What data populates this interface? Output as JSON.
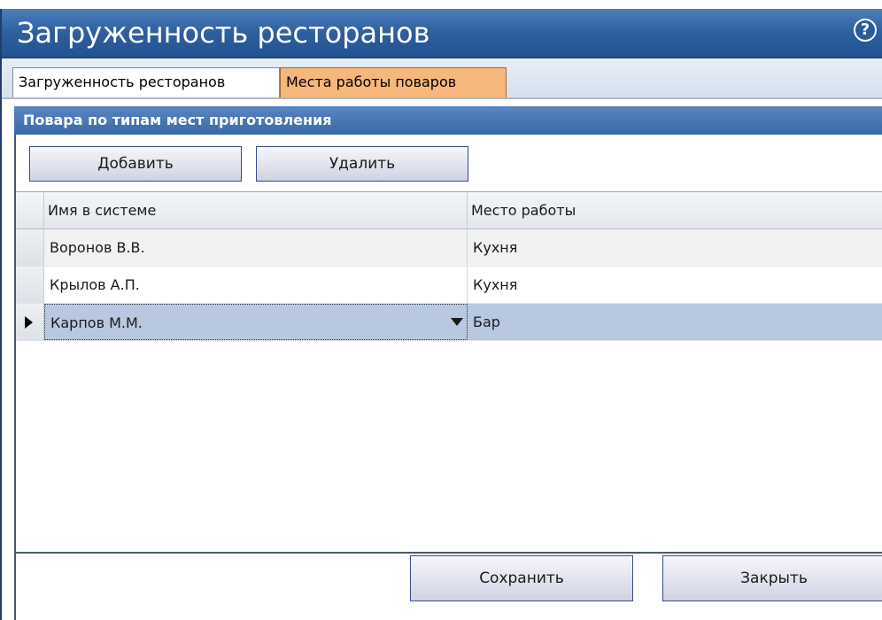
{
  "window": {
    "title": "Загруженность ресторанов",
    "help_icon": "question-circle-icon"
  },
  "tabs": [
    {
      "label": "Загруженность ресторанов",
      "active": false
    },
    {
      "label": "Места работы поваров",
      "active": true
    }
  ],
  "section": {
    "header": "Повара по типам мест приготовления"
  },
  "toolbar": {
    "add_label": "Добавить",
    "delete_label": "Удалить"
  },
  "grid": {
    "columns": [
      "Имя в системе",
      "Место работы"
    ],
    "rows": [
      {
        "name": "Воронов В.В.",
        "place": "Кухня",
        "selected": false
      },
      {
        "name": "Крылов А.П.",
        "place": "Кухня",
        "selected": false
      },
      {
        "name": "Карпов М.М.",
        "place": "Бар",
        "selected": true
      }
    ]
  },
  "footer": {
    "save_label": "Сохранить",
    "close_label": "Закрыть"
  },
  "colors": {
    "titlebar": "#2e5f9f",
    "active_tab": "#f7b67a",
    "selected_row": "#b8c8e0"
  }
}
